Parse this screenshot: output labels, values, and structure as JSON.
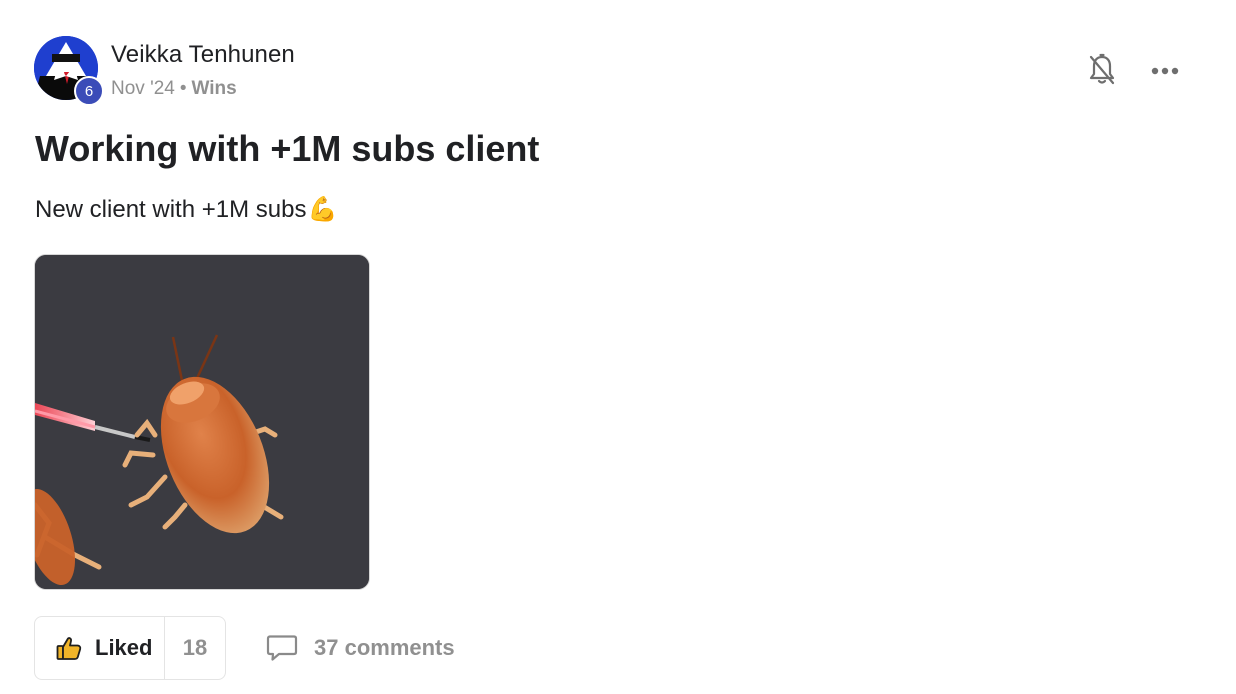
{
  "author": {
    "name": "Veikka Tenhunen",
    "level": "6",
    "avatar_icon": "abstract-avatar-icon"
  },
  "meta": {
    "date": "Nov '24",
    "separator": "•",
    "category": "Wins"
  },
  "actions": {
    "bell_icon": "bell-off-icon",
    "more_icon": "more-horizontal-icon"
  },
  "post": {
    "title": "Working with +1M subs client",
    "body": "New client with +1M subs",
    "body_emoji": "💪",
    "attachment": "animated-gif-cockroach-lightsaber"
  },
  "footer": {
    "like_label": "Liked",
    "like_count": "18",
    "comments_label": "37 comments"
  },
  "colors": {
    "text": "#202124",
    "muted": "#909090",
    "badge": "#3b4cb8",
    "avatar_bg": "#1f3fcf",
    "like_icon": "#f0b429"
  }
}
